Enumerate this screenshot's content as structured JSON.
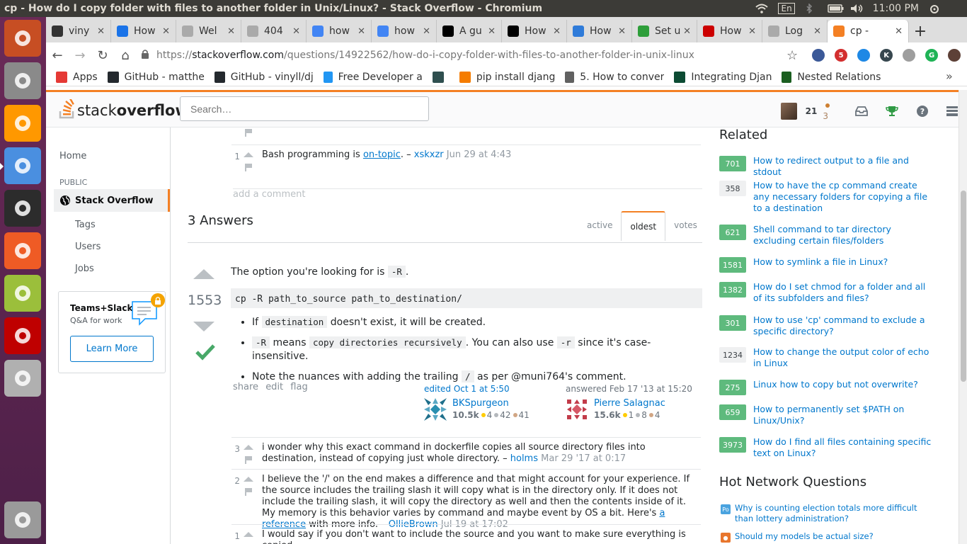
{
  "os": {
    "window_title": "cp - How do I copy folder with files to another folder in Unix/Linux? - Stack Overflow - Chromium",
    "keyboard_layout": "En",
    "clock": "11:00 PM"
  },
  "launcher": [
    {
      "name": "ubuntu-dash",
      "color": "#c74e23"
    },
    {
      "name": "files",
      "color": "#8a8a8a"
    },
    {
      "name": "sublime-text",
      "color": "#ff9800"
    },
    {
      "name": "chromium",
      "color": "#4a8fe0"
    },
    {
      "name": "terminal",
      "color": "#2c2c2c"
    },
    {
      "name": "postman",
      "color": "#ef5b25"
    },
    {
      "name": "image-viewer",
      "color": "#9bbf3b"
    },
    {
      "name": "filezilla",
      "color": "#bf0000"
    },
    {
      "name": "disk",
      "color": "#b0b0b0"
    },
    {
      "name": "trash",
      "color": "#9a9a9a"
    }
  ],
  "tabs": [
    {
      "title": "viny",
      "fav": "github",
      "color": "#333333"
    },
    {
      "title": "How",
      "fav": "blue-swirl",
      "color": "#1a73e8"
    },
    {
      "title": "Wel",
      "fav": "page",
      "color": "#aaaaaa"
    },
    {
      "title": "404",
      "fav": "page",
      "color": "#aaaaaa"
    },
    {
      "title": "how",
      "fav": "google",
      "color": "#4285f4"
    },
    {
      "title": "how",
      "fav": "google",
      "color": "#4285f4"
    },
    {
      "title": "A gu",
      "fav": "medium",
      "color": "#000000"
    },
    {
      "title": "How",
      "fav": "medium",
      "color": "#000000"
    },
    {
      "title": "How",
      "fav": "angular-a",
      "color": "#2f7bd9"
    },
    {
      "title": "Set u",
      "fav": "green-flag",
      "color": "#2e9e3a"
    },
    {
      "title": "How",
      "fav": "redhat",
      "color": "#cc0000"
    },
    {
      "title": "Log",
      "fav": "page",
      "color": "#aaaaaa"
    }
  ],
  "active_tab": {
    "title": "cp - ",
    "fav": "so",
    "color": "#f48024"
  },
  "omnibox": {
    "scheme": "https://",
    "host": "stackoverflow.com",
    "path": "/questions/14922562/how-do-i-copy-folder-with-files-to-another-folder-in-unix-linux"
  },
  "extensions": [
    {
      "label": "",
      "color": "#3b5998"
    },
    {
      "label": "5",
      "color": "#d32f2f"
    },
    {
      "label": "",
      "color": "#1e88e5"
    },
    {
      "label": "K",
      "color": "#37474f"
    },
    {
      "label": "",
      "color": "#9e9e9e"
    },
    {
      "label": "G",
      "color": "#1fb356"
    },
    {
      "label": "",
      "color": "#5d4037"
    }
  ],
  "bookmarks": [
    {
      "label": "Apps",
      "icon": "apps-grid",
      "color": "#e53935"
    },
    {
      "label": "GitHub - matthe",
      "icon": "github",
      "color": "#24292e"
    },
    {
      "label": "GitHub - vinyll/dj",
      "icon": "github",
      "color": "#24292e"
    },
    {
      "label": "Free Developer a",
      "icon": "T",
      "color": "#2196f3"
    },
    {
      "label": "",
      "icon": "diamond",
      "color": "#2f4f4f"
    },
    {
      "label": "pip install djang",
      "icon": "snake",
      "color": "#f57c00"
    },
    {
      "label": "5. How to conver",
      "icon": "book",
      "color": "#616161"
    },
    {
      "label": "Integrating Djan",
      "icon": "dj",
      "color": "#0c4b33"
    },
    {
      "label": "Nested Relations",
      "icon": "N",
      "color": "#1b5e20"
    }
  ],
  "so": {
    "logo_light": "stack",
    "logo_bold": "overflow",
    "search_placeholder": "Search…",
    "reputation": "21",
    "bronze_badges": "3"
  },
  "left_nav": {
    "home": "Home",
    "public": "PUBLIC",
    "stack_overflow": "Stack Overflow",
    "tags": "Tags",
    "users": "Users",
    "jobs": "Jobs",
    "teams_title": "Teams+Slack",
    "teams_sub": "Q&A for work",
    "learn_more": "Learn More"
  },
  "question_comments": [
    {
      "score": "",
      "text": "Bash programming is ",
      "link": "on-topic",
      "after": ". – ",
      "user": "xskxzr",
      "date": "Jun 29 at 4:43",
      "score_shown": "1"
    }
  ],
  "add_comment": "add a comment",
  "answers": {
    "count_title": "3 Answers",
    "sort_tabs": [
      "active",
      "oldest",
      "votes"
    ],
    "active_sort": "oldest"
  },
  "answer": {
    "score": "1553",
    "intro": "The option you're looking for is ",
    "intro_code": "-R",
    "intro_end": ".",
    "code_block": "cp -R path_to_source path_to_destination/",
    "bullets": [
      {
        "pre": "If ",
        "code": "destination",
        "post": " doesn't exist, it will be created."
      },
      {
        "pre": "",
        "code": "-R",
        "post": " means ",
        "code2": "copy directories recursively",
        "post2": ". You can also use ",
        "code3": "-r",
        "post3": " since it's case-insensitive."
      },
      {
        "pre": "Note the nuances with adding the trailing ",
        "code": "/",
        "post": " as per @muni764's comment."
      }
    ],
    "menu": [
      "share",
      "edit",
      "flag"
    ],
    "editor": {
      "action": "edited Oct 1 at 5:50",
      "name": "BKSpurgeon",
      "rep": "10.5k",
      "gold": "4",
      "silver": "42",
      "bronze": "41"
    },
    "author": {
      "action": "answered Feb 17 '13 at 15:20",
      "name": "Pierre Salagnac",
      "rep": "15.6k",
      "gold": "1",
      "silver": "8",
      "bronze": "4"
    }
  },
  "answer_comments": [
    {
      "score": "3",
      "text": "i wonder why this exact command in dockerfile copies all source directory files into destination, instead of copying just whole directory. – ",
      "user": "holms",
      "date": "Mar 29 '17 at 0:17"
    },
    {
      "score": "2",
      "text": "I believe the '/' on the end makes a difference and that might account for your experience. If the source includes the trailing slash it will copy what is in the directory only. If it does not include the trailing slash, it will copy the directory as well and then the contents inside of it. My memory is this behavior varies by command and maybe event by OS a bit. Here's ",
      "link": "a reference",
      "after": " with more info. – ",
      "user": "OllieBrown",
      "date": "Jul 19 at 17:02"
    },
    {
      "score": "1",
      "text": "I would say if you don't want to include the source and you want to make sure everything is copied",
      "user": "",
      "date": ""
    }
  ],
  "related": {
    "title": "Related",
    "items": [
      {
        "score": "701",
        "accepted": true,
        "title": "How to redirect output to a file and stdout"
      },
      {
        "score": "358",
        "accepted": false,
        "title": "How to have the cp command create any necessary folders for copying a file to a destination"
      },
      {
        "score": "621",
        "accepted": true,
        "title": "Shell command to tar directory excluding certain files/folders"
      },
      {
        "score": "1581",
        "accepted": true,
        "title": "How to symlink a file in Linux?"
      },
      {
        "score": "1382",
        "accepted": true,
        "title": "How do I set chmod for a folder and all of its subfolders and files?"
      },
      {
        "score": "301",
        "accepted": true,
        "title": "How to use 'cp' command to exclude a specific directory?"
      },
      {
        "score": "1234",
        "accepted": false,
        "title": "How to change the output color of echo in Linux"
      },
      {
        "score": "275",
        "accepted": true,
        "title": "Linux how to copy but not overwrite?"
      },
      {
        "score": "659",
        "accepted": true,
        "title": "How to permanently set $PATH on Linux/Unix?"
      },
      {
        "score": "3973",
        "accepted": true,
        "title": "How do I find all files containing specific text on Linux?"
      }
    ]
  },
  "hot_network": {
    "title": "Hot Network Questions",
    "items": [
      {
        "title": "Why is counting election totals more difficult than lottery administration?",
        "icon_color": "#4aa3df",
        "icon_text": "Po"
      },
      {
        "title": "Should my models be actual size?",
        "icon_color": "#e8762d",
        "icon_text": "●"
      }
    ]
  }
}
